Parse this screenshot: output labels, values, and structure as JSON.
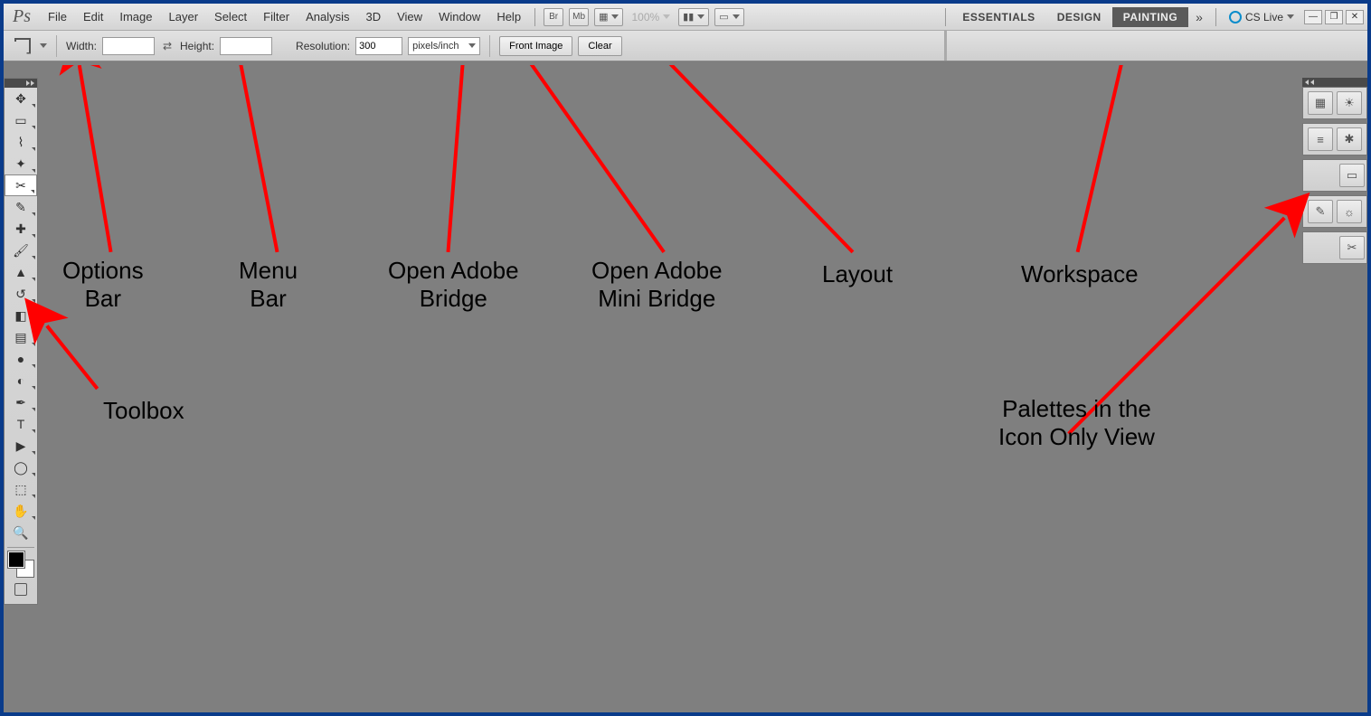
{
  "app": {
    "logo": "Ps"
  },
  "menu": [
    "File",
    "Edit",
    "Image",
    "Layer",
    "Select",
    "Filter",
    "Analysis",
    "3D",
    "View",
    "Window",
    "Help"
  ],
  "topbar": {
    "bridge_label": "Br",
    "minibridge_label": "Mb",
    "zoom_label": "100%"
  },
  "workspaces": {
    "tabs": [
      "ESSENTIALS",
      "DESIGN",
      "PAINTING"
    ],
    "active_index": 2,
    "more": "»"
  },
  "cslive": {
    "label": "CS Live"
  },
  "options": {
    "width_label": "Width:",
    "width_value": "",
    "height_label": "Height:",
    "height_value": "",
    "resolution_label": "Resolution:",
    "resolution_value": "300",
    "unit": "pixels/inch",
    "btn1": "Front Image",
    "btn2": "Clear"
  },
  "toolbox": {
    "tools": [
      "move",
      "marquee",
      "lasso",
      "wand",
      "crop",
      "eyedropper",
      "healing",
      "brush",
      "stamp",
      "history-brush",
      "eraser",
      "gradient",
      "blur",
      "dodge",
      "pen",
      "type",
      "path-select",
      "shape",
      "3d",
      "hand",
      "zoom"
    ]
  },
  "palettes": {
    "groups": [
      [
        "palette-a",
        "palette-b"
      ],
      [
        "palette-c",
        "palette-d"
      ],
      [
        "palette-e"
      ],
      [
        "palette-f",
        "palette-g"
      ],
      [
        "palette-h"
      ]
    ]
  },
  "annotations": {
    "options_bar_l1": "Options",
    "options_bar_l2": "Bar",
    "menu_bar_l1": "Menu",
    "menu_bar_l2": "Bar",
    "bridge_l1": "Open Adobe",
    "bridge_l2": "Bridge",
    "mini_l1": "Open Adobe",
    "mini_l2": "Mini Bridge",
    "layout": "Layout",
    "workspace": "Workspace",
    "toolbox": "Toolbox",
    "palettes_l1": "Palettes in the",
    "palettes_l2": "Icon Only View"
  }
}
